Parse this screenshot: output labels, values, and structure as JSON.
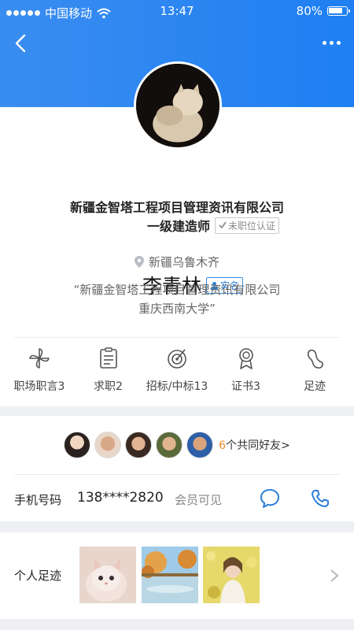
{
  "status_bar": {
    "carrier": "中国移动",
    "time": "13:47",
    "battery": "80%"
  },
  "nav": {
    "back_icon": "back-arrow-icon",
    "more_icon": "more-dots-icon"
  },
  "profile": {
    "name": "李青林",
    "realname_badge": "实名",
    "company": "新疆金智塔工程项目管理资讯有限公司",
    "job_title": "一级建造师",
    "unverified_badge": "未职位认证",
    "location": "新疆乌鲁木齐",
    "quote_line1": "“新疆金智塔工程项目管理资讯有限公司",
    "quote_line2": "重庆西南大学”"
  },
  "stats": [
    {
      "label": "职场职言3",
      "icon": "pinwheel-icon"
    },
    {
      "label": "求职2",
      "icon": "clipboard-icon"
    },
    {
      "label": "招标/中标13",
      "icon": "target-icon"
    },
    {
      "label": "证书3",
      "icon": "award-icon"
    },
    {
      "label": "足迹",
      "icon": "footprint-icon"
    }
  ],
  "friends": {
    "count": "6",
    "text": "个共同好友>"
  },
  "phone": {
    "label": "手机号码",
    "number": "138****2820",
    "note": "会员可见"
  },
  "footprint": {
    "label": "个人足迹"
  },
  "colors": {
    "accent": "#2d7fd8",
    "header": "#2a86f1",
    "count": "#f08a24"
  }
}
